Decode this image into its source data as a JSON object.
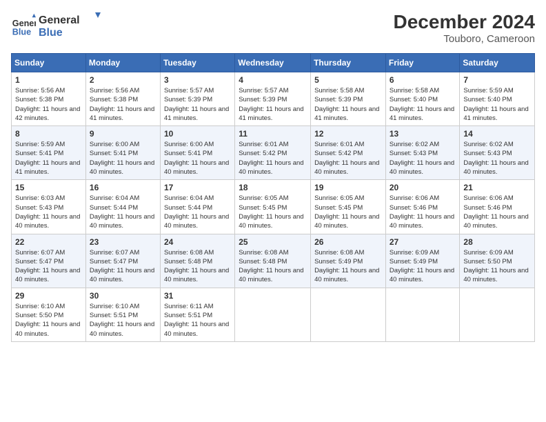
{
  "header": {
    "logo_line1": "General",
    "logo_line2": "Blue",
    "month_year": "December 2024",
    "location": "Touboro, Cameroon"
  },
  "weekdays": [
    "Sunday",
    "Monday",
    "Tuesday",
    "Wednesday",
    "Thursday",
    "Friday",
    "Saturday"
  ],
  "weeks": [
    [
      {
        "day": "1",
        "info": "Sunrise: 5:56 AM\nSunset: 5:38 PM\nDaylight: 11 hours and 42 minutes."
      },
      {
        "day": "2",
        "info": "Sunrise: 5:56 AM\nSunset: 5:38 PM\nDaylight: 11 hours and 41 minutes."
      },
      {
        "day": "3",
        "info": "Sunrise: 5:57 AM\nSunset: 5:39 PM\nDaylight: 11 hours and 41 minutes."
      },
      {
        "day": "4",
        "info": "Sunrise: 5:57 AM\nSunset: 5:39 PM\nDaylight: 11 hours and 41 minutes."
      },
      {
        "day": "5",
        "info": "Sunrise: 5:58 AM\nSunset: 5:39 PM\nDaylight: 11 hours and 41 minutes."
      },
      {
        "day": "6",
        "info": "Sunrise: 5:58 AM\nSunset: 5:40 PM\nDaylight: 11 hours and 41 minutes."
      },
      {
        "day": "7",
        "info": "Sunrise: 5:59 AM\nSunset: 5:40 PM\nDaylight: 11 hours and 41 minutes."
      }
    ],
    [
      {
        "day": "8",
        "info": "Sunrise: 5:59 AM\nSunset: 5:41 PM\nDaylight: 11 hours and 41 minutes."
      },
      {
        "day": "9",
        "info": "Sunrise: 6:00 AM\nSunset: 5:41 PM\nDaylight: 11 hours and 40 minutes."
      },
      {
        "day": "10",
        "info": "Sunrise: 6:00 AM\nSunset: 5:41 PM\nDaylight: 11 hours and 40 minutes."
      },
      {
        "day": "11",
        "info": "Sunrise: 6:01 AM\nSunset: 5:42 PM\nDaylight: 11 hours and 40 minutes."
      },
      {
        "day": "12",
        "info": "Sunrise: 6:01 AM\nSunset: 5:42 PM\nDaylight: 11 hours and 40 minutes."
      },
      {
        "day": "13",
        "info": "Sunrise: 6:02 AM\nSunset: 5:43 PM\nDaylight: 11 hours and 40 minutes."
      },
      {
        "day": "14",
        "info": "Sunrise: 6:02 AM\nSunset: 5:43 PM\nDaylight: 11 hours and 40 minutes."
      }
    ],
    [
      {
        "day": "15",
        "info": "Sunrise: 6:03 AM\nSunset: 5:43 PM\nDaylight: 11 hours and 40 minutes."
      },
      {
        "day": "16",
        "info": "Sunrise: 6:04 AM\nSunset: 5:44 PM\nDaylight: 11 hours and 40 minutes."
      },
      {
        "day": "17",
        "info": "Sunrise: 6:04 AM\nSunset: 5:44 PM\nDaylight: 11 hours and 40 minutes."
      },
      {
        "day": "18",
        "info": "Sunrise: 6:05 AM\nSunset: 5:45 PM\nDaylight: 11 hours and 40 minutes."
      },
      {
        "day": "19",
        "info": "Sunrise: 6:05 AM\nSunset: 5:45 PM\nDaylight: 11 hours and 40 minutes."
      },
      {
        "day": "20",
        "info": "Sunrise: 6:06 AM\nSunset: 5:46 PM\nDaylight: 11 hours and 40 minutes."
      },
      {
        "day": "21",
        "info": "Sunrise: 6:06 AM\nSunset: 5:46 PM\nDaylight: 11 hours and 40 minutes."
      }
    ],
    [
      {
        "day": "22",
        "info": "Sunrise: 6:07 AM\nSunset: 5:47 PM\nDaylight: 11 hours and 40 minutes."
      },
      {
        "day": "23",
        "info": "Sunrise: 6:07 AM\nSunset: 5:47 PM\nDaylight: 11 hours and 40 minutes."
      },
      {
        "day": "24",
        "info": "Sunrise: 6:08 AM\nSunset: 5:48 PM\nDaylight: 11 hours and 40 minutes."
      },
      {
        "day": "25",
        "info": "Sunrise: 6:08 AM\nSunset: 5:48 PM\nDaylight: 11 hours and 40 minutes."
      },
      {
        "day": "26",
        "info": "Sunrise: 6:08 AM\nSunset: 5:49 PM\nDaylight: 11 hours and 40 minutes."
      },
      {
        "day": "27",
        "info": "Sunrise: 6:09 AM\nSunset: 5:49 PM\nDaylight: 11 hours and 40 minutes."
      },
      {
        "day": "28",
        "info": "Sunrise: 6:09 AM\nSunset: 5:50 PM\nDaylight: 11 hours and 40 minutes."
      }
    ],
    [
      {
        "day": "29",
        "info": "Sunrise: 6:10 AM\nSunset: 5:50 PM\nDaylight: 11 hours and 40 minutes."
      },
      {
        "day": "30",
        "info": "Sunrise: 6:10 AM\nSunset: 5:51 PM\nDaylight: 11 hours and 40 minutes."
      },
      {
        "day": "31",
        "info": "Sunrise: 6:11 AM\nSunset: 5:51 PM\nDaylight: 11 hours and 40 minutes."
      },
      null,
      null,
      null,
      null
    ]
  ]
}
